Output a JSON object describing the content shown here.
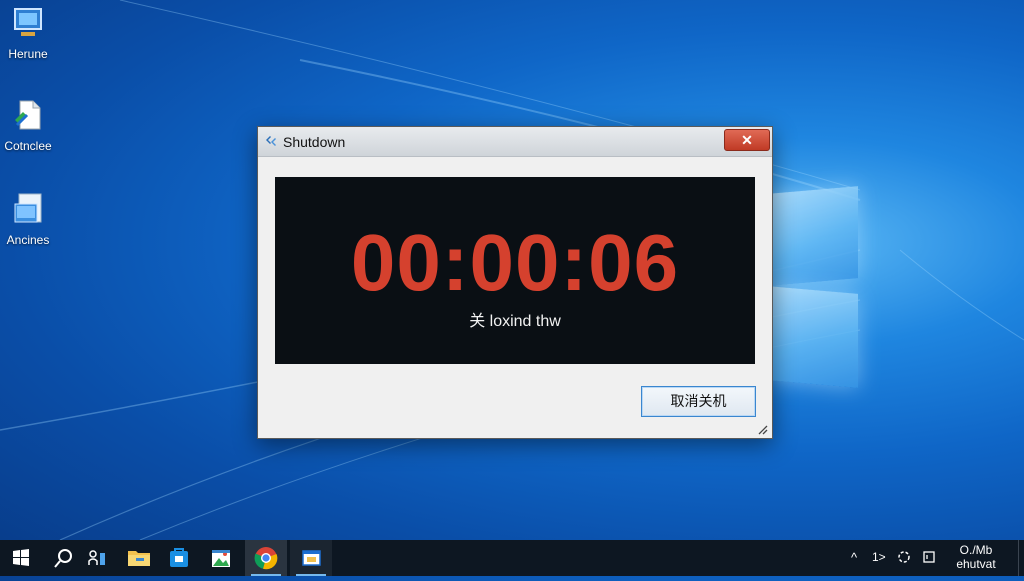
{
  "desktop": {
    "icons": [
      {
        "label": "Herune",
        "icon": "computer-icon"
      },
      {
        "label": "Cotnclee",
        "icon": "file-shortcut-icon"
      },
      {
        "label": "Ancines",
        "icon": "folder-icon"
      }
    ]
  },
  "dialog": {
    "title": "Shutdown",
    "close_label": "✕",
    "timer": "00:00:06",
    "subtitle": "关 loxind thw",
    "cancel_label": "取消关机"
  },
  "taskbar": {
    "apps": [
      "start-icon",
      "search-icon",
      "people-icon",
      "file-explorer-icon",
      "store-icon",
      "photos-icon",
      "chrome-icon",
      "window-app-icon"
    ],
    "tray": {
      "chevron": "^",
      "tray_text": "1>",
      "clock_line1": "O./Mb",
      "clock_line2": "ehutvat"
    }
  },
  "colors": {
    "timer": "#d5412e",
    "close_button": "#c8432e",
    "cancel_border": "#3a86cf",
    "taskbar": "#0d1722"
  }
}
